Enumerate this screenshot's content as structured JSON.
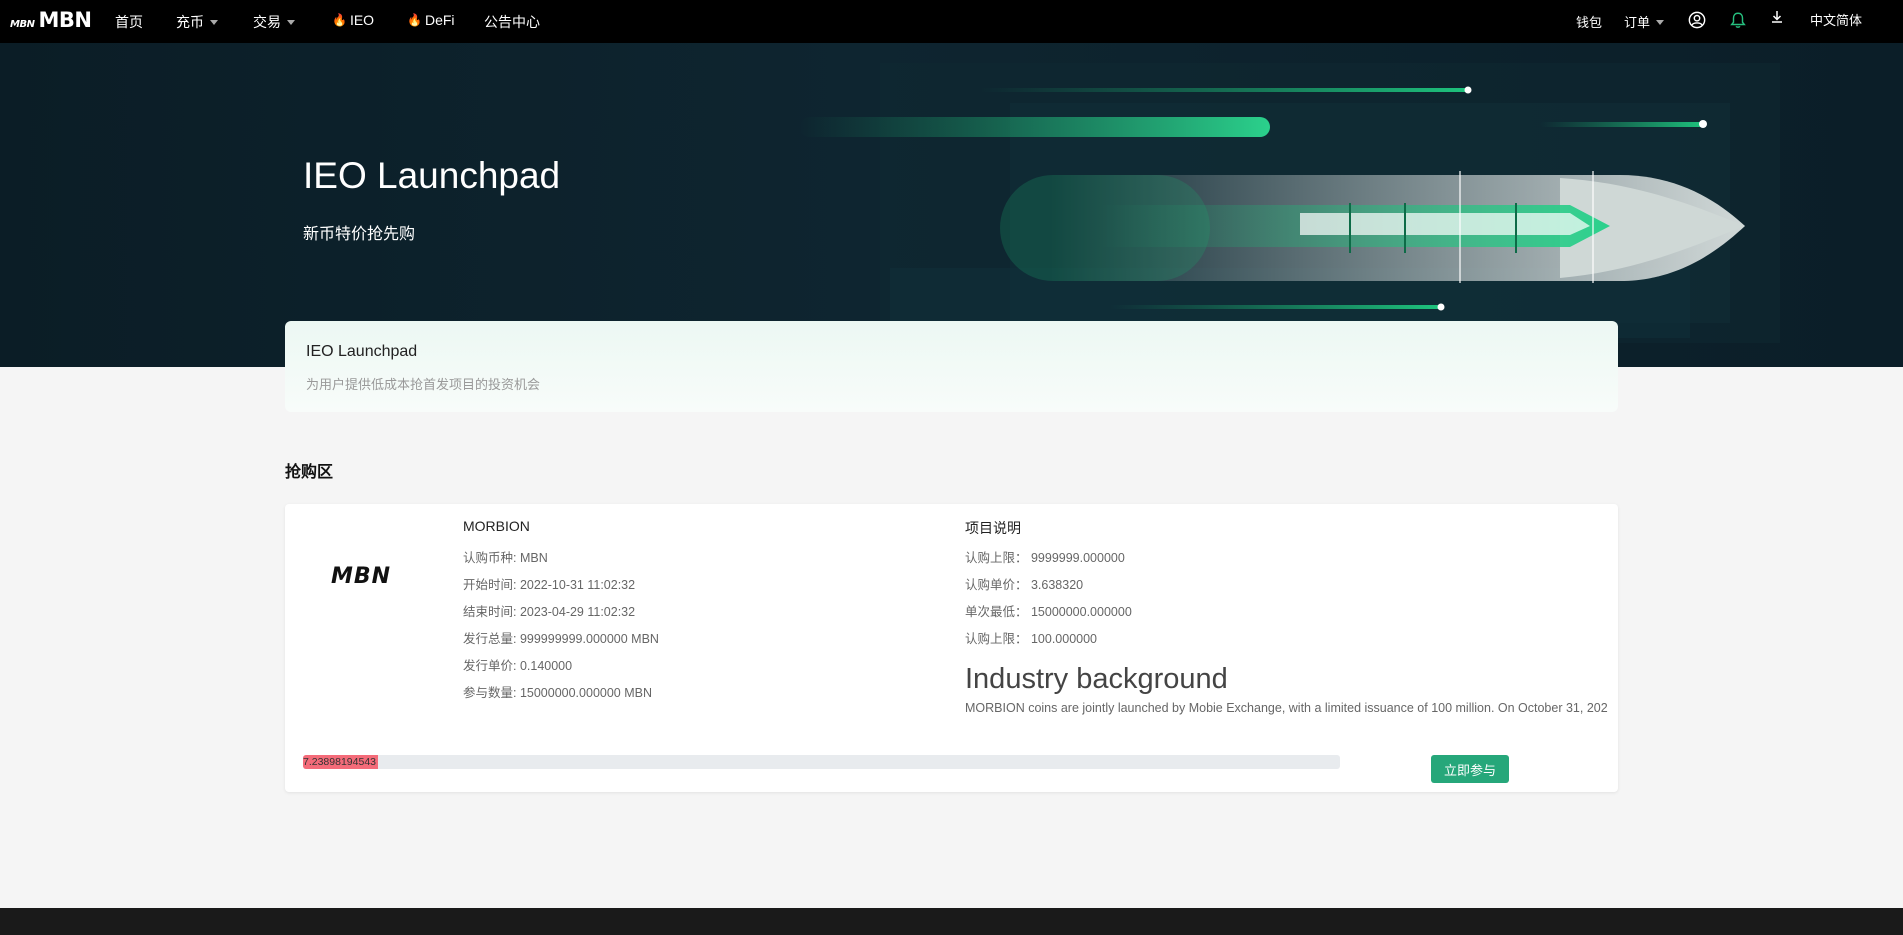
{
  "nav": {
    "logo_mark": "MBN",
    "logo_text": "MBN",
    "items": [
      {
        "label": "首页"
      },
      {
        "label": "充币"
      },
      {
        "label": "交易"
      },
      {
        "label": "IEO"
      },
      {
        "label": "DeFi"
      },
      {
        "label": "公告中心"
      }
    ],
    "right": {
      "wallet": "钱包",
      "orders": "订单",
      "language": "中文简体"
    }
  },
  "hero": {
    "title": "IEO Launchpad",
    "subtitle": "新币特价抢先购"
  },
  "intro": {
    "title": "IEO Launchpad",
    "subtitle": "为用户提供低成本抢首发项目的投资机会"
  },
  "section_title": "抢购区",
  "project": {
    "logo_text": "MBN",
    "name": "MORBION",
    "details": [
      "认购币种:  MBN",
      "开始时间:  2022-10-31 11:02:32",
      "结束时间:  2023-04-29 11:02:32",
      "发行总量:  999999999.000000 MBN",
      "发行单价:  0.140000",
      "参与数量:  15000000.000000 MBN"
    ],
    "desc_title": "项目说明",
    "desc_rows": [
      "认购上限：  9999999.000000",
      "认购单价：  3.638320",
      "单次最低：  15000000.000000",
      "认购上限：  100.000000"
    ],
    "background_title": "Industry background",
    "background_text": "MORBION coins are jointly launched by Mobie Exchange, with a limited issuance of 100 million. On October 31, 202",
    "progress_label": "7.23898194543",
    "progress_percent": 7.23898194543,
    "join_label": "立即参与"
  },
  "colors": {
    "accent": "#26a77a",
    "progress": "#f46b79",
    "nav_bg": "#000000",
    "hero_bg": "#0e2530"
  }
}
